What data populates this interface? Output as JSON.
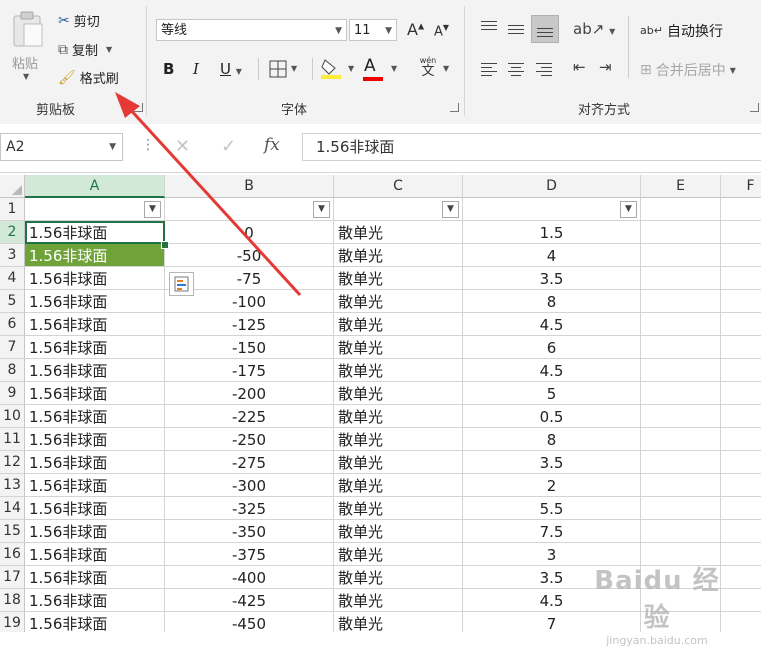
{
  "clipboard": {
    "paste_label": "粘贴",
    "cut_label": "剪切",
    "copy_label": "复制",
    "format_painter_label": "格式刷",
    "group_label": "剪贴板"
  },
  "font": {
    "font_name": "等线",
    "font_size": "11",
    "bold": "B",
    "italic": "I",
    "underline": "U",
    "font_color_letter": "A",
    "phonetic_label": "wén",
    "phonetic_char": "文",
    "grow_letter": "A",
    "shrink_letter": "A",
    "group_label": "字体"
  },
  "alignment": {
    "wrap_text_label": "自动换行",
    "merge_center_label": "合并后居中",
    "group_label": "对齐方式"
  },
  "formula_bar": {
    "name_box": "A2",
    "fx": "fx",
    "value": "1.56非球面"
  },
  "columns": [
    "A",
    "B",
    "C",
    "D",
    "E",
    "F"
  ],
  "row_numbers": [
    "1",
    "2",
    "3",
    "4",
    "5",
    "6",
    "7",
    "8",
    "9",
    "10",
    "11",
    "12",
    "13",
    "14",
    "15",
    "16",
    "17",
    "18",
    "19"
  ],
  "rows": [
    [
      "1.56非球面",
      "0",
      "散单光",
      "1.5"
    ],
    [
      "1.56非球面",
      "-50",
      "散单光",
      "4"
    ],
    [
      "1.56非球面",
      "-75",
      "散单光",
      "3.5"
    ],
    [
      "1.56非球面",
      "-100",
      "散单光",
      "8"
    ],
    [
      "1.56非球面",
      "-125",
      "散单光",
      "4.5"
    ],
    [
      "1.56非球面",
      "-150",
      "散单光",
      "6"
    ],
    [
      "1.56非球面",
      "-175",
      "散单光",
      "4.5"
    ],
    [
      "1.56非球面",
      "-200",
      "散单光",
      "5"
    ],
    [
      "1.56非球面",
      "-225",
      "散单光",
      "0.5"
    ],
    [
      "1.56非球面",
      "-250",
      "散单光",
      "8"
    ],
    [
      "1.56非球面",
      "-275",
      "散单光",
      "3.5"
    ],
    [
      "1.56非球面",
      "-300",
      "散单光",
      "2"
    ],
    [
      "1.56非球面",
      "-325",
      "散单光",
      "5.5"
    ],
    [
      "1.56非球面",
      "-350",
      "散单光",
      "7.5"
    ],
    [
      "1.56非球面",
      "-375",
      "散单光",
      "3"
    ],
    [
      "1.56非球面",
      "-400",
      "散单光",
      "3.5"
    ],
    [
      "1.56非球面",
      "-425",
      "散单光",
      "4.5"
    ],
    [
      "1.56非球面",
      "-450",
      "散单光",
      "7"
    ]
  ],
  "colors": {
    "excel_green": "#217346",
    "selected_fill": "#70a23a",
    "annotation_red": "#e53935"
  },
  "watermark": {
    "brand": "Baidu 经验",
    "url": "jingyan.baidu.com"
  }
}
